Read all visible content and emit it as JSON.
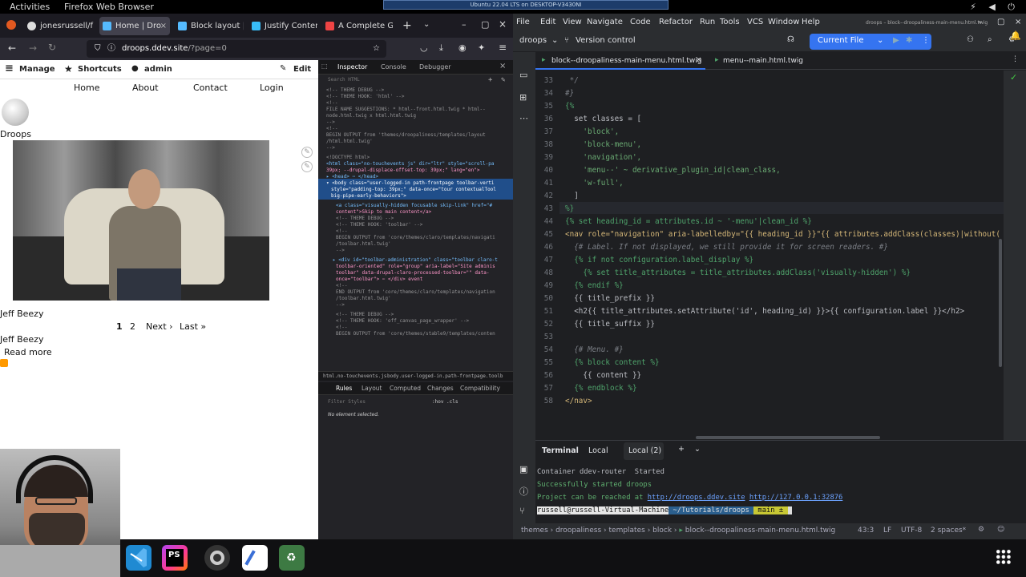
{
  "topbar": {
    "activities": "Activities",
    "app": "Firefox Web Browser",
    "remote_title": "Ubuntu 22.04 LTS on DESKTOP-V3430NI"
  },
  "browser": {
    "tabs": [
      {
        "label": "jonesrussell/f"
      },
      {
        "label": "Home | Dro"
      },
      {
        "label": "Block layout |"
      },
      {
        "label": "Justify Conten"
      },
      {
        "label": "A Complete G"
      }
    ],
    "url_host": "droops.ddev.site",
    "url_path": "/?page=0"
  },
  "drupal": {
    "toolbar": {
      "manage": "Manage",
      "shortcuts": "Shortcuts",
      "user": "admin",
      "edit": "Edit"
    },
    "nav": [
      "Home",
      "About",
      "Contact",
      "Login"
    ],
    "site_name": "Droops",
    "caption1": "Jeff Beezy",
    "pager": {
      "current": "1",
      "page2": "2",
      "next": "Next ›",
      "last": "Last »"
    },
    "caption2": "Jeff Beezy",
    "read_more": "Read more"
  },
  "devtools": {
    "tabs": {
      "inspector": "Inspector",
      "console": "Console",
      "debugger": "Debugger"
    },
    "search_placeholder": "Search HTML",
    "lines": [
      "<!-- THEME DEBUG -->",
      "<!-- THEME HOOK: 'html' -->",
      "<!--",
      "FILE NAME SUGGESTIONS: * html--front.html.twig * html--",
      "node.html.twig x html.html.twig",
      "-->",
      "<!--",
      "BEGIN OUTPUT from 'themes/droopaliness/templates/layout",
      "/html.html.twig'",
      "-->",
      "<!DOCTYPE html>",
      "<html class=\"no-touchevents js\" dir=\"ltr\" style=\"scroll-pa",
      "39px; --drupal-displace-offset-top: 39px;\" lang=\"en\">",
      "▸ <head> ⋯ </head>",
      "▾ <body class=\"user-logged-in path-frontpage toolbar-verti",
      "style=\"padding-top: 39px;\" data-once=\"tour contextualTool",
      "big-pipe-early-behaviors\">",
      "<a class=\"visually-hidden focusable skip-link\" href=\"#",
      "content\">Skip to main content</a>",
      "<!-- THEME DEBUG -->",
      "<!-- THEME HOOK: 'toolbar' -->",
      "<!--",
      "BEGIN OUTPUT from 'core/themes/claro/templates/navigati",
      "/toolbar.html.twig'",
      "-->",
      "▸ <div id=\"toolbar-administration\" class=\"toolbar claro-t",
      "toolbar-oriented\" role=\"group\" aria-label=\"Site adminis",
      "toolbar\" data-drupal-claro-processed-toolbar=\"\" data-",
      "once=\"toolbar\"> ⋯ </div> event",
      "<!--",
      "END OUTPUT from 'core/themes/claro/templates/navigation",
      "/toolbar.html.twig'",
      "-->",
      "<!-- THEME DEBUG -->",
      "<!-- THEME HOOK: 'off_canvas_page_wrapper' -->",
      "<!--",
      "BEGIN OUTPUT from 'core/themes/stable9/templates/conten"
    ],
    "breadcrumb": [
      "html.no-touchevents.js",
      "body.user-logged-in.path-frontpage.toolb"
    ],
    "rules_tabs": [
      "Rules",
      "Layout",
      "Computed",
      "Changes",
      "Compatibility"
    ],
    "filter_placeholder": "Filter Styles",
    "hov": ":hov",
    "cls": ".cls",
    "no_element": "No element selected."
  },
  "phpstorm": {
    "window_title": "droops – block--droopaliness-main-menu.html.twig",
    "menu": [
      "File",
      "Edit",
      "View",
      "Navigate",
      "Code",
      "Refactor",
      "Run",
      "Tools",
      "VCS",
      "Window",
      "Help"
    ],
    "project": "droops",
    "vcs": "Version control",
    "run_config": "Current File",
    "editor_tabs": [
      "block--droopaliness-main-menu.html.twig",
      "menu--main.html.twig"
    ],
    "code": [
      {
        "n": "33",
        "t": " */"
      },
      {
        "n": "34",
        "t": "#}"
      },
      {
        "n": "35",
        "t": "{%"
      },
      {
        "n": "36",
        "t": "  set classes = ["
      },
      {
        "n": "37",
        "t": "    'block',"
      },
      {
        "n": "38",
        "t": "    'block-menu',"
      },
      {
        "n": "39",
        "t": "    'navigation',"
      },
      {
        "n": "40",
        "t": "    'menu--' ~ derivative_plugin_id|clean_class,"
      },
      {
        "n": "41",
        "t": "    'w-full',"
      },
      {
        "n": "42",
        "t": "  ]"
      },
      {
        "n": "43",
        "t": "%}"
      },
      {
        "n": "44",
        "t": "{% set heading_id = attributes.id ~ '-menu'|clean_id %}"
      },
      {
        "n": "45",
        "t": "<nav role=\"navigation\" aria-labelledby=\"{{ heading_id }}\"{{ attributes.addClass(classes)|without("
      },
      {
        "n": "46",
        "t": "  {# Label. If not displayed, we still provide it for screen readers. #}"
      },
      {
        "n": "47",
        "t": "  {% if not configuration.label_display %}"
      },
      {
        "n": "48",
        "t": "    {% set title_attributes = title_attributes.addClass('visually-hidden') %}"
      },
      {
        "n": "49",
        "t": "  {% endif %}"
      },
      {
        "n": "50",
        "t": "  {{ title_prefix }}"
      },
      {
        "n": "51",
        "t": "  <h2{{ title_attributes.setAttribute('id', heading_id) }}>{{ configuration.label }}</h2>"
      },
      {
        "n": "52",
        "t": "  {{ title_suffix }}"
      },
      {
        "n": "53",
        "t": ""
      },
      {
        "n": "54",
        "t": "  {# Menu. #}"
      },
      {
        "n": "55",
        "t": "  {% block content %}"
      },
      {
        "n": "56",
        "t": "    {{ content }}"
      },
      {
        "n": "57",
        "t": "  {% endblock %}"
      },
      {
        "n": "58",
        "t": "</nav>"
      }
    ],
    "terminal": {
      "tabs": [
        "Terminal",
        "Local",
        "Local (2)"
      ],
      "lines": [
        "Container ddev-router  Started",
        "Successfully started droops"
      ],
      "reach_prefix": "Project can be reached at ",
      "url1": "http://droops.ddev.site",
      "url2": "http://127.0.0.1:32876",
      "prompt_user": "russell@russell-Virtual-Machine",
      "prompt_path": "~/Tutorials/droops",
      "prompt_branch": " main ± "
    },
    "status": {
      "crumbs": [
        "themes",
        "droopaliness",
        "templates",
        "block",
        "block--droopaliness-main-menu.html.twig"
      ],
      "pos": "43:3",
      "eol": "LF",
      "enc": "UTF-8",
      "indent": "2 spaces*"
    }
  }
}
